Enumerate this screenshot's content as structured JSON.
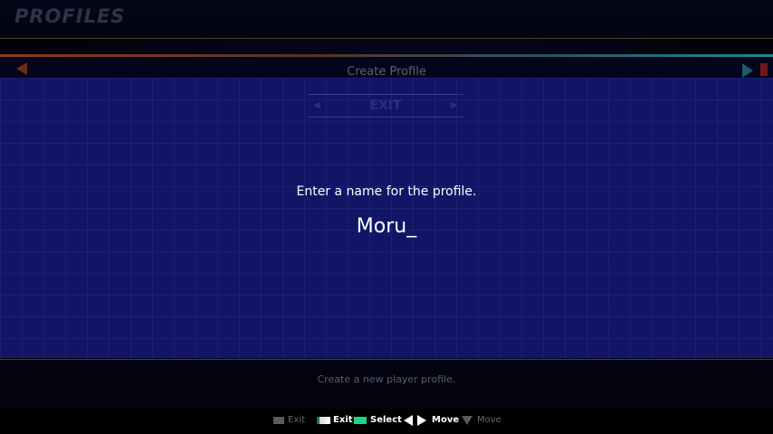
{
  "header": {
    "title": "PROFILES"
  },
  "subheader": {
    "title": "Create Profile"
  },
  "background_menu": {
    "exit_label": "EXIT"
  },
  "dialog": {
    "prompt": "Enter a name for the profile.",
    "name_value": "Moru_"
  },
  "description": "Create a new player profile.",
  "footer": {
    "hints": [
      {
        "label": "Exit",
        "icon": "key-gray-icon"
      },
      {
        "label": "Exit",
        "icon": "key-white-icon"
      },
      {
        "label": "Select",
        "icon": "key-green-icon"
      },
      {
        "label": "Move",
        "icon": "left-right-arrows-icon"
      },
      {
        "label": "Move",
        "icon": "down-arrow-icon"
      }
    ]
  },
  "colors": {
    "dialog_bg": "#121566",
    "accent_orange": "#8a3a1c",
    "accent_teal": "#1e8a8e",
    "key_green": "#17d88a"
  }
}
